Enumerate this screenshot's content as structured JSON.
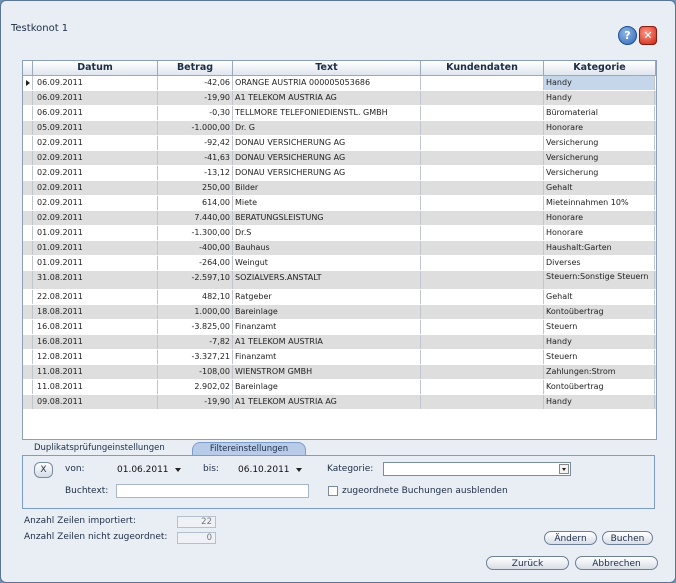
{
  "window": {
    "title": "Testkonot 1"
  },
  "icons": {
    "help": "help-icon",
    "close": "close-icon"
  },
  "table": {
    "headers": [
      "Datum",
      "Betrag",
      "Text",
      "Kundendaten",
      "Kategorie"
    ],
    "rows": [
      {
        "date": "06.09.2011",
        "amount": "-42,06",
        "text": "ORANGE AUSTRIA 000005053686",
        "kd": "",
        "cat": "Handy"
      },
      {
        "date": "06.09.2011",
        "amount": "-19,90",
        "text": "A1 TELEKOM AUSTRIA AG",
        "kd": "",
        "cat": "Handy"
      },
      {
        "date": "06.09.2011",
        "amount": "-0,30",
        "text": "TELLMORE TELEFONIEDIENSTL. GMBH",
        "kd": "",
        "cat": "Büromaterial"
      },
      {
        "date": "05.09.2011",
        "amount": "-1.000,00",
        "text": "Dr. G",
        "kd": "",
        "cat": "Honorare"
      },
      {
        "date": "02.09.2011",
        "amount": "-92,42",
        "text": "DONAU VERSICHERUNG AG",
        "kd": "",
        "cat": "Versicherung"
      },
      {
        "date": "02.09.2011",
        "amount": "-41,63",
        "text": "DONAU VERSICHERUNG AG",
        "kd": "",
        "cat": "Versicherung"
      },
      {
        "date": "02.09.2011",
        "amount": "-13,12",
        "text": "DONAU VERSICHERUNG AG",
        "kd": "",
        "cat": "Versicherung"
      },
      {
        "date": "02.09.2011",
        "amount": "250,00",
        "text": "Bilder",
        "kd": "",
        "cat": "Gehalt"
      },
      {
        "date": "02.09.2011",
        "amount": "614,00",
        "text": "Miete",
        "kd": "",
        "cat": "Mieteinnahmen 10%"
      },
      {
        "date": "02.09.2011",
        "amount": "7.440,00",
        "text": "BERATUNGSLEISTUNG",
        "kd": "",
        "cat": "Honorare"
      },
      {
        "date": "01.09.2011",
        "amount": "-1.300,00",
        "text": "Dr.S",
        "kd": "",
        "cat": "Honorare"
      },
      {
        "date": "01.09.2011",
        "amount": "-400,00",
        "text": "Bauhaus",
        "kd": "",
        "cat": "Haushalt:Garten"
      },
      {
        "date": "01.09.2011",
        "amount": "-264,00",
        "text": "Weingut",
        "kd": "",
        "cat": "Diverses"
      },
      {
        "date": "31.08.2011",
        "amount": "-2.597,10",
        "text": "SOZIALVERS.ANSTALT",
        "kd": "",
        "cat": "Steuern:Sonstige Steuern"
      },
      {
        "date": "22.08.2011",
        "amount": "482,10",
        "text": "Ratgeber",
        "kd": "",
        "cat": "Gehalt"
      },
      {
        "date": "18.08.2011",
        "amount": "1.000,00",
        "text": "Bareinlage",
        "kd": "",
        "cat": "Kontoübertrag"
      },
      {
        "date": "16.08.2011",
        "amount": "-3.825,00",
        "text": "Finanzamt",
        "kd": "",
        "cat": "Steuern"
      },
      {
        "date": "16.08.2011",
        "amount": "-7,82",
        "text": "A1 TELEKOM AUSTRIA",
        "kd": "",
        "cat": "Handy"
      },
      {
        "date": "12.08.2011",
        "amount": "-3.327,21",
        "text": "Finanzamt",
        "kd": "",
        "cat": "Steuern"
      },
      {
        "date": "11.08.2011",
        "amount": "-108,00",
        "text": "WIENSTROM GMBH",
        "kd": "",
        "cat": "Zahlungen:Strom"
      },
      {
        "date": "11.08.2011",
        "amount": "2.902,02",
        "text": "Bareinlage",
        "kd": "",
        "cat": "Kontoübertrag"
      },
      {
        "date": "09.08.2011",
        "amount": "-19,90",
        "text": "A1 TELEKOM AUSTRIA AG",
        "kd": "",
        "cat": "Handy"
      }
    ]
  },
  "tabs": {
    "dup": "Duplikatsprüfungeinstellungen",
    "filter": "Filtereinstellungen"
  },
  "filter": {
    "x_label": "X",
    "von_label": "von:",
    "von_value": "01.06.2011",
    "bis_label": "bis:",
    "bis_value": "06.10.2011",
    "kategorie_label": "Kategorie:",
    "kategorie_value": "",
    "buchtext_label": "Buchtext:",
    "buchtext_value": "",
    "hide_label": "zugeordnete Buchungen ausblenden"
  },
  "stats": {
    "imported_label": "Anzahl Zeilen importiert:",
    "imported_value": "22",
    "unassigned_label": "Anzahl Zeilen nicht zugeordnet:",
    "unassigned_value": "0"
  },
  "buttons": {
    "andern": "Ändern",
    "buchen": "Buchen",
    "zuruck": "Zurück",
    "abbrechen": "Abbrechen"
  }
}
